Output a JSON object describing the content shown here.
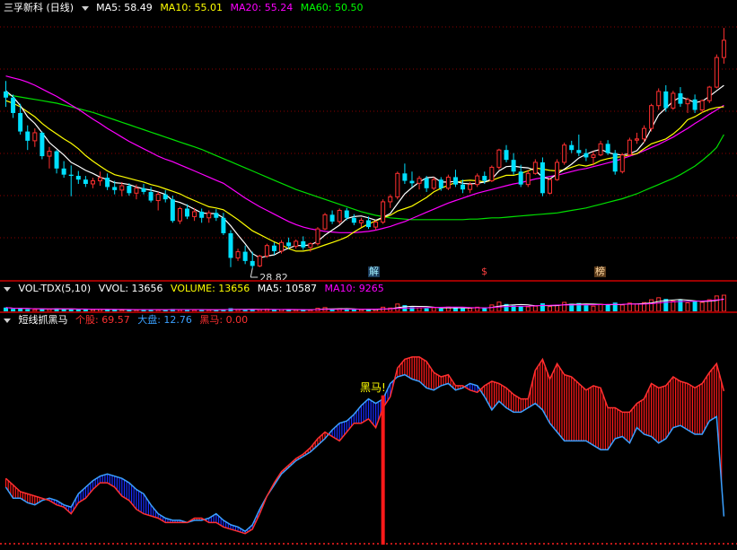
{
  "main": {
    "title": "三孚新科 (日线)",
    "ma": [
      {
        "label": "MA5: 58.49",
        "color": "#ffffff"
      },
      {
        "label": "MA10: 55.01",
        "color": "#ffff00"
      },
      {
        "label": "MA20: 55.24",
        "color": "#ff00ff"
      },
      {
        "label": "MA60: 50.50",
        "color": "#00ff00"
      }
    ],
    "low_label": "28.82",
    "markers": [
      {
        "text": "解",
        "color": "#a0f0ff",
        "bg": "#1a3a5a"
      },
      {
        "text": "$",
        "color": "#ff4040",
        "bg": "#000"
      },
      {
        "text": "榜",
        "color": "#ffd8a0",
        "bg": "#5a3a1a"
      }
    ]
  },
  "volume": {
    "title": "VOL-TDX(5,10)",
    "items": [
      {
        "label": "VVOL: 13656",
        "color": "#ffffff"
      },
      {
        "label": "VOLUME: 13656",
        "color": "#ffff00"
      },
      {
        "label": "MA5: 10587",
        "color": "#ffffff"
      },
      {
        "label": "MA10: 9265",
        "color": "#ff00ff"
      }
    ]
  },
  "indicator": {
    "title": "短线抓黑马",
    "items": [
      {
        "label": "个股: 69.57",
        "color": "#ff3030"
      },
      {
        "label": "大盘: 12.76",
        "color": "#3aa0ff"
      },
      {
        "label": "黑马: 0.00",
        "color": "#ff3030"
      }
    ],
    "signal_label": "黑马!"
  },
  "colors": {
    "up": "#ff3030",
    "down": "#00e0ff",
    "bg": "#000000",
    "grid": "#8b0000"
  },
  "chart_data": {
    "type": "candlestick",
    "price_candles": [
      [
        57.5,
        59.2,
        55.0,
        56.5
      ],
      [
        56.5,
        57.0,
        53.2,
        54.0
      ],
      [
        54.0,
        55.5,
        50.5,
        51.0
      ],
      [
        51.0,
        52.0,
        48.0,
        49.5
      ],
      [
        49.5,
        51.5,
        48.5,
        50.8
      ],
      [
        50.8,
        51.0,
        46.5,
        47.0
      ],
      [
        47.0,
        48.5,
        45.0,
        47.8
      ],
      [
        47.8,
        48.0,
        44.2,
        45.0
      ],
      [
        45.0,
        46.2,
        43.5,
        44.0
      ],
      [
        44.0,
        45.5,
        40.5,
        43.8
      ],
      [
        43.8,
        44.6,
        42.5,
        43.2
      ],
      [
        43.2,
        43.8,
        42.0,
        42.5
      ],
      [
        42.5,
        43.5,
        41.8,
        43.0
      ],
      [
        43.0,
        44.5,
        42.2,
        43.5
      ],
      [
        43.5,
        44.2,
        41.5,
        42.0
      ],
      [
        42.0,
        43.0,
        40.8,
        41.5
      ],
      [
        41.5,
        42.8,
        40.5,
        42.2
      ],
      [
        42.2,
        42.6,
        40.6,
        41.0
      ],
      [
        41.0,
        42.4,
        40.0,
        41.8
      ],
      [
        41.8,
        42.5,
        40.8,
        41.2
      ],
      [
        41.2,
        42.0,
        39.5,
        39.8
      ],
      [
        39.8,
        41.2,
        38.2,
        40.8
      ],
      [
        40.8,
        41.5,
        39.5,
        40.0
      ],
      [
        40.0,
        40.6,
        36.2,
        36.5
      ],
      [
        36.5,
        38.8,
        36.0,
        38.5
      ],
      [
        38.5,
        39.2,
        36.8,
        37.2
      ],
      [
        37.2,
        38.6,
        36.5,
        38.0
      ],
      [
        38.0,
        38.5,
        36.2,
        37.0
      ],
      [
        37.0,
        38.2,
        36.2,
        37.8
      ],
      [
        37.8,
        38.4,
        36.5,
        37.0
      ],
      [
        37.0,
        37.8,
        34.2,
        34.5
      ],
      [
        34.5,
        35.0,
        29.0,
        30.5
      ],
      [
        30.5,
        32.0,
        30.0,
        31.5
      ],
      [
        31.5,
        32.5,
        29.5,
        30.0
      ],
      [
        30.0,
        31.5,
        28.82,
        29.2
      ],
      [
        29.2,
        31.0,
        29.0,
        30.8
      ],
      [
        30.8,
        32.8,
        30.5,
        32.5
      ],
      [
        32.5,
        33.0,
        31.0,
        31.6
      ],
      [
        31.6,
        33.4,
        31.2,
        33.0
      ],
      [
        33.0,
        33.8,
        32.0,
        32.4
      ],
      [
        32.4,
        33.5,
        32.0,
        33.2
      ],
      [
        33.2,
        34.0,
        31.8,
        32.2
      ],
      [
        32.2,
        33.0,
        31.5,
        32.8
      ],
      [
        32.8,
        35.5,
        32.5,
        35.2
      ],
      [
        35.2,
        37.8,
        35.0,
        37.5
      ],
      [
        37.5,
        38.2,
        36.0,
        36.4
      ],
      [
        36.4,
        38.5,
        36.0,
        38.2
      ],
      [
        38.2,
        38.6,
        36.6,
        37.0
      ],
      [
        37.0,
        37.6,
        35.8,
        36.2
      ],
      [
        36.2,
        37.0,
        35.5,
        36.6
      ],
      [
        36.6,
        37.2,
        35.2,
        35.5
      ],
      [
        35.5,
        36.6,
        35.0,
        36.3
      ],
      [
        36.3,
        40.0,
        36.0,
        39.6
      ],
      [
        39.6,
        40.8,
        38.6,
        40.4
      ],
      [
        40.4,
        44.5,
        40.0,
        44.2
      ],
      [
        44.2,
        45.8,
        42.5,
        43.0
      ],
      [
        43.0,
        44.5,
        42.0,
        42.6
      ],
      [
        42.6,
        43.8,
        41.6,
        43.4
      ],
      [
        43.4,
        43.8,
        41.2,
        41.8
      ],
      [
        41.8,
        43.6,
        41.5,
        43.2
      ],
      [
        43.2,
        43.6,
        41.4,
        41.8
      ],
      [
        41.8,
        44.0,
        41.5,
        43.6
      ],
      [
        43.6,
        44.8,
        42.0,
        42.4
      ],
      [
        42.4,
        43.2,
        41.0,
        41.6
      ],
      [
        41.6,
        42.8,
        41.0,
        42.4
      ],
      [
        42.4,
        44.2,
        42.0,
        43.8
      ],
      [
        43.8,
        44.5,
        42.5,
        43.0
      ],
      [
        43.0,
        45.5,
        42.8,
        45.2
      ],
      [
        45.2,
        48.2,
        44.8,
        48.0
      ],
      [
        48.0,
        48.8,
        46.0,
        46.4
      ],
      [
        46.4,
        47.5,
        44.0,
        44.5
      ],
      [
        44.5,
        45.6,
        42.0,
        42.4
      ],
      [
        42.4,
        44.8,
        42.0,
        44.2
      ],
      [
        44.2,
        46.5,
        44.0,
        46.0
      ],
      [
        46.0,
        46.8,
        40.5,
        41.0
      ],
      [
        41.0,
        43.5,
        40.8,
        43.2
      ],
      [
        43.2,
        46.5,
        43.0,
        46.0
      ],
      [
        46.0,
        49.2,
        45.6,
        48.8
      ],
      [
        48.8,
        49.5,
        47.5,
        48.0
      ],
      [
        48.0,
        50.5,
        47.0,
        47.5
      ],
      [
        47.5,
        48.2,
        46.2,
        46.8
      ],
      [
        46.8,
        47.8,
        45.5,
        47.2
      ],
      [
        47.2,
        49.5,
        47.0,
        49.0
      ],
      [
        49.0,
        49.6,
        47.2,
        47.5
      ],
      [
        47.5,
        48.0,
        44.0,
        44.5
      ],
      [
        44.5,
        47.5,
        44.2,
        47.2
      ],
      [
        47.2,
        50.0,
        47.0,
        49.6
      ],
      [
        49.6,
        50.8,
        49.0,
        49.8
      ],
      [
        49.8,
        52.0,
        49.2,
        51.5
      ],
      [
        51.5,
        55.5,
        51.0,
        55.2
      ],
      [
        55.2,
        58.0,
        54.5,
        57.5
      ],
      [
        57.5,
        58.5,
        54.2,
        54.8
      ],
      [
        54.8,
        57.6,
        54.5,
        57.2
      ],
      [
        57.2,
        58.2,
        55.0,
        55.5
      ],
      [
        55.5,
        56.5,
        54.0,
        56.2
      ],
      [
        56.2,
        57.0,
        54.0,
        54.5
      ],
      [
        54.5,
        56.2,
        54.0,
        56.0
      ],
      [
        56.0,
        58.4,
        55.6,
        58.2
      ],
      [
        58.2,
        63.5,
        58.0,
        63.0
      ],
      [
        63.0,
        67.8,
        62.0,
        65.8
      ]
    ],
    "ma5": [
      57.6,
      56.6,
      55.2,
      53.4,
      52.3,
      50.8,
      49.2,
      48.2,
      47.2,
      46.0,
      45.4,
      44.7,
      44.2,
      43.6,
      43.2,
      42.7,
      42.6,
      42.4,
      42.0,
      41.7,
      41.5,
      41.2,
      40.8,
      39.8,
      39.5,
      39.0,
      38.4,
      37.8,
      37.7,
      37.7,
      37.0,
      35.7,
      34.2,
      32.8,
      31.2,
      30.5,
      30.8,
      31.0,
      31.6,
      32.1,
      32.5,
      32.5,
      32.6,
      33.2,
      34.2,
      35.0,
      35.8,
      36.9,
      37.2,
      37.3,
      37.0,
      36.6,
      37.1,
      37.7,
      39.3,
      40.9,
      41.9,
      42.8,
      43.5,
      43.6,
      42.8,
      42.8,
      42.9,
      42.6,
      42.5,
      42.6,
      42.8,
      43.3,
      44.6,
      45.3,
      45.4,
      45.2,
      45.1,
      44.7,
      43.6,
      43.3,
      44.1,
      44.9,
      45.7,
      46.7,
      47.3,
      47.8,
      48.1,
      47.6,
      47.3,
      47.2,
      47.4,
      47.9,
      49.3,
      51.5,
      53.7,
      54.8,
      55.9,
      56.6,
      56.2,
      55.7,
      55.9,
      56.7,
      57.6,
      58.49
    ],
    "ma10": [
      56.0,
      55.6,
      55.0,
      54.2,
      53.4,
      52.3,
      51.4,
      50.6,
      49.8,
      49.1,
      48.2,
      47.1,
      46.2,
      45.4,
      44.6,
      44.0,
      43.7,
      43.4,
      43.1,
      42.8,
      42.4,
      42.1,
      41.7,
      41.3,
      40.9,
      40.3,
      39.8,
      39.3,
      38.8,
      38.6,
      38.3,
      37.5,
      36.7,
      35.8,
      34.9,
      34.3,
      33.7,
      33.1,
      32.6,
      32.0,
      31.6,
      31.6,
      31.8,
      32.2,
      32.6,
      33.0,
      33.4,
      33.9,
      34.7,
      35.4,
      36.0,
      36.5,
      37.0,
      37.4,
      38.1,
      38.5,
      38.9,
      39.6,
      40.3,
      41.2,
      41.8,
      42.3,
      42.7,
      43.0,
      43.1,
      43.0,
      42.8,
      43.1,
      43.5,
      43.9,
      43.9,
      44.2,
      44.6,
      45.1,
      44.9,
      44.7,
      44.6,
      44.8,
      45.2,
      45.6,
      45.4,
      45.7,
      46.3,
      46.6,
      46.8,
      46.9,
      47.2,
      47.4,
      48.2,
      49.0,
      49.4,
      49.8,
      50.6,
      51.6,
      52.9,
      53.4,
      54.1,
      54.6,
      54.9,
      55.01
    ],
    "ma20": [
      60.0,
      59.7,
      59.4,
      59.0,
      58.5,
      57.9,
      57.3,
      56.7,
      56.0,
      55.3,
      54.6,
      53.8,
      53.0,
      52.3,
      51.5,
      50.8,
      50.1,
      49.4,
      48.8,
      48.2,
      47.6,
      47.0,
      46.5,
      46.1,
      45.6,
      45.1,
      44.6,
      44.1,
      43.6,
      43.1,
      42.6,
      41.8,
      41.0,
      40.2,
      39.5,
      38.8,
      38.2,
      37.6,
      37.0,
      36.4,
      35.9,
      35.5,
      35.2,
      35.0,
      34.8,
      34.7,
      34.6,
      34.6,
      34.6,
      34.7,
      34.8,
      35.0,
      35.3,
      35.6,
      36.0,
      36.4,
      36.9,
      37.4,
      37.9,
      38.4,
      38.9,
      39.4,
      39.8,
      40.2,
      40.6,
      41.0,
      41.3,
      41.6,
      41.9,
      42.2,
      42.5,
      42.7,
      43.0,
      43.3,
      43.5,
      43.7,
      43.9,
      44.2,
      44.5,
      44.8,
      45.0,
      45.3,
      45.6,
      45.9,
      46.2,
      46.6,
      47.0,
      47.4,
      47.9,
      48.4,
      48.9,
      49.5,
      50.1,
      50.8,
      51.5,
      52.3,
      53.0,
      53.8,
      54.5,
      55.24
    ],
    "ma60": [
      57.0,
      56.8,
      56.6,
      56.4,
      56.2,
      56.0,
      55.8,
      55.6,
      55.3,
      55.0,
      54.7,
      54.4,
      54.1,
      53.7,
      53.3,
      52.9,
      52.5,
      52.1,
      51.7,
      51.3,
      50.9,
      50.5,
      50.1,
      49.7,
      49.3,
      48.9,
      48.5,
      48.1,
      47.6,
      47.1,
      46.6,
      46.1,
      45.6,
      45.1,
      44.6,
      44.1,
      43.6,
      43.1,
      42.6,
      42.1,
      41.6,
      41.2,
      40.8,
      40.4,
      40.0,
      39.6,
      39.2,
      38.8,
      38.4,
      38.0,
      37.7,
      37.4,
      37.2,
      37.0,
      36.9,
      36.8,
      36.7,
      36.7,
      36.7,
      36.7,
      36.7,
      36.7,
      36.7,
      36.7,
      36.8,
      36.8,
      36.9,
      37.0,
      37.0,
      37.1,
      37.2,
      37.3,
      37.4,
      37.5,
      37.6,
      37.7,
      37.8,
      38.0,
      38.2,
      38.4,
      38.6,
      38.9,
      39.2,
      39.5,
      39.8,
      40.1,
      40.5,
      40.9,
      41.4,
      41.9,
      42.4,
      42.9,
      43.4,
      44.0,
      44.7,
      45.4,
      46.3,
      47.3,
      48.4,
      50.5
    ],
    "volume": [
      3200,
      2100,
      2500,
      1800,
      1500,
      2300,
      1700,
      2600,
      1900,
      1600,
      1500,
      2000,
      1400,
      1700,
      1300,
      1500,
      1200,
      1700,
      1300,
      1400,
      1600,
      1200,
      1500,
      2000,
      1300,
      1500,
      1200,
      1400,
      1300,
      1100,
      1700,
      2600,
      1500,
      1800,
      1500,
      1400,
      1900,
      1300,
      1500,
      1200,
      1300,
      1500,
      1200,
      2600,
      3200,
      1800,
      2200,
      1600,
      1500,
      1400,
      1600,
      1500,
      3500,
      2800,
      6200,
      5200,
      3600,
      3000,
      2600,
      3100,
      2400,
      3600,
      3200,
      2500,
      2600,
      3500,
      2800,
      5400,
      7800,
      6200,
      5000,
      4600,
      3800,
      4400,
      6800,
      4000,
      5200,
      7600,
      6500,
      7000,
      5200,
      4400,
      6000,
      5600,
      7400,
      5400,
      7000,
      6200,
      7400,
      9800,
      11500,
      10500,
      8600,
      9800,
      7200,
      8400,
      7600,
      9800,
      13000,
      13656
    ],
    "indicator_stock": [
      30,
      27,
      24,
      23,
      22,
      21,
      20,
      18,
      17,
      14,
      19,
      21,
      25,
      28,
      28,
      26,
      22,
      20,
      16,
      14,
      13,
      12,
      10,
      10,
      10,
      10,
      12,
      12,
      10,
      10,
      8,
      7,
      6,
      5,
      7,
      14,
      22,
      28,
      33,
      36,
      39,
      41,
      44,
      48,
      51,
      49,
      47,
      51,
      55,
      55,
      57,
      53,
      62,
      67,
      80,
      84,
      85,
      85,
      83,
      78,
      76,
      77,
      72,
      72,
      70,
      69,
      72,
      74,
      73,
      71,
      68,
      66,
      66,
      79,
      84,
      75,
      82,
      77,
      76,
      73,
      70,
      72,
      71,
      62,
      62,
      60,
      60,
      64,
      66,
      73,
      71,
      72,
      76,
      74,
      73,
      71,
      73,
      78,
      82,
      69.57
    ],
    "indicator_market": [
      26,
      21,
      21,
      19,
      18,
      20,
      21,
      20,
      18,
      17,
      23,
      26,
      29,
      31,
      32,
      31,
      30,
      28,
      25,
      23,
      18,
      14,
      12,
      11,
      11,
      10,
      11,
      11,
      12,
      14,
      11,
      9,
      8,
      6,
      9,
      16,
      22,
      27,
      32,
      35,
      38,
      40,
      42,
      45,
      48,
      52,
      55,
      56,
      59,
      63,
      66,
      64,
      66,
      73,
      76,
      77,
      75,
      74,
      71,
      70,
      72,
      73,
      70,
      71,
      73,
      72,
      67,
      61,
      65,
      62,
      60,
      60,
      62,
      64,
      61,
      55,
      51,
      47,
      47,
      47,
      47,
      45,
      43,
      43,
      48,
      49,
      46,
      53,
      50,
      49,
      46,
      48,
      53,
      54,
      52,
      50,
      50,
      56,
      58,
      12.76
    ],
    "signal_index": 52,
    "main_range": [
      27.8,
      70.0
    ],
    "indicator_range": [
      0,
      100
    ]
  }
}
